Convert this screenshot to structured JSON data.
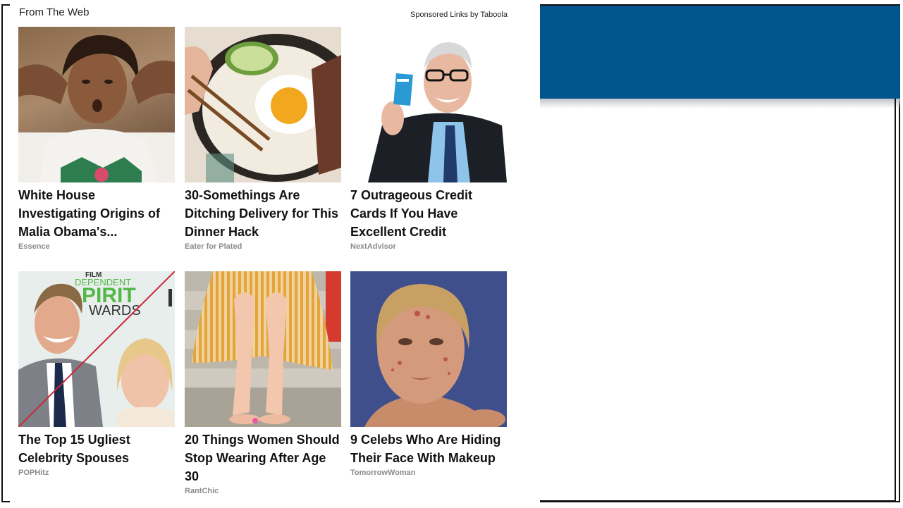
{
  "widget": {
    "title": "From The Web",
    "sponsored": "Sponsored Links by Taboola"
  },
  "cards": [
    {
      "headline": "White House Investigating Origins of Malia Obama's...",
      "source": "Essence",
      "image": "young-woman-photo"
    },
    {
      "headline": "30-Somethings Are Ditching Delivery for This Dinner Hack",
      "source": "Eater for Plated",
      "image": "rice-bowl-photo"
    },
    {
      "headline": "7 Outrageous Credit Cards If You Have Excellent Credit",
      "source": "NextAdvisor",
      "image": "man-with-credit-card-photo"
    },
    {
      "headline": "The Top 15 Ugliest Celebrity Spouses",
      "source": "POPHitz",
      "image": "celebrity-couple-photo"
    },
    {
      "headline": "20 Things Women Should Stop Wearing After Age 30",
      "source": "RantChic",
      "image": "woman-legs-dress-photo"
    },
    {
      "headline": "9 Celebs Who Are Hiding Their Face With Makeup",
      "source": "TomorrowWoman",
      "image": "woman-face-acne-photo"
    }
  ],
  "thumb_text": {
    "film": "FILM",
    "dependent": "DEPENDENT",
    "pirit": "PIRIT",
    "wards": "WARDS"
  },
  "colors": {
    "banner": "#00558f",
    "headline": "#111111",
    "source": "#8a8a8a"
  }
}
